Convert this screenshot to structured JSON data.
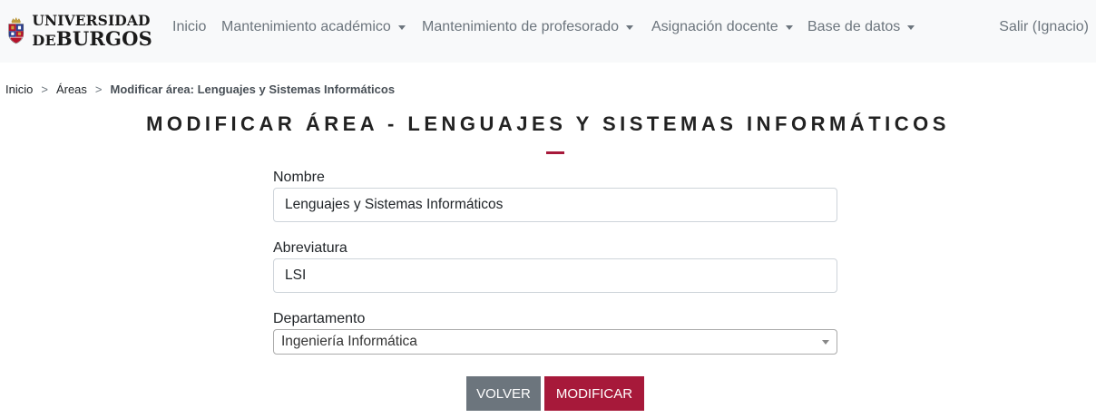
{
  "brand": {
    "line1": "UNIVERSIDAD",
    "line2_prefix": "DE",
    "line2_main": "BURGOS",
    "colors": {
      "crest_red": "#b5122a",
      "crest_blue": "#2c3f8f",
      "gold": "#c8a13a"
    }
  },
  "nav": {
    "items": [
      {
        "label": "Inicio"
      },
      {
        "label": "Mantenimiento académico"
      },
      {
        "label": "Mantenimiento de profesorado"
      },
      {
        "label": "Asignación docente"
      },
      {
        "label": "Base de datos"
      }
    ],
    "logout": "Salir (Ignacio)"
  },
  "breadcrumb": {
    "items": [
      "Inicio",
      "Áreas"
    ],
    "separator": ">",
    "current": "Modificar área: Lenguajes y Sistemas Informáticos"
  },
  "page": {
    "title": "MODIFICAR ÁREA - LENGUAJES Y SISTEMAS INFORMÁTICOS",
    "accent": "#a7193a"
  },
  "form": {
    "nombre": {
      "label": "Nombre",
      "value": "Lenguajes y Sistemas Informáticos"
    },
    "abreviatura": {
      "label": "Abreviatura",
      "value": "LSI"
    },
    "departamento": {
      "label": "Departamento",
      "selected": "Ingeniería Informática"
    }
  },
  "buttons": {
    "back": "VOLVER",
    "submit": "MODIFICAR"
  }
}
